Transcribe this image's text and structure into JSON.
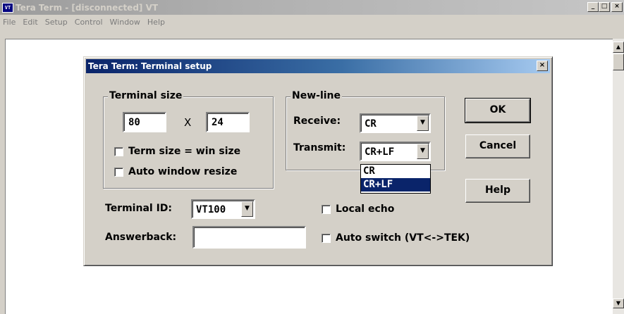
{
  "window": {
    "icon_text": "VT",
    "title": "Tera Term - [disconnected] VT",
    "min_glyph": "_",
    "max_glyph": "□",
    "close_glyph": "×"
  },
  "menu": [
    "File",
    "Edit",
    "Setup",
    "Control",
    "Window",
    "Help"
  ],
  "scrollbar": {
    "up_glyph": "▲",
    "down_glyph": "▼"
  },
  "dialog": {
    "title": "Tera Term: Terminal setup",
    "close_glyph": "×",
    "terminal_size": {
      "legend": "Terminal size",
      "cols": "80",
      "sep": "X",
      "rows": "24",
      "term_size_eq_win": {
        "label": "Term size = win size",
        "checked": false
      },
      "auto_resize": {
        "label": "Auto window resize",
        "checked": false
      }
    },
    "newline": {
      "legend": "New-line",
      "receive_label": "Receive:",
      "receive_value": "CR",
      "transmit_label": "Transmit:",
      "transmit_value": "CR+LF",
      "transmit_options": [
        "CR",
        "CR+LF"
      ],
      "transmit_selected": "CR+LF"
    },
    "terminal_id": {
      "label": "Terminal ID:",
      "value": "VT100"
    },
    "answerback": {
      "label": "Answerback:",
      "value": ""
    },
    "local_echo": {
      "label": "Local echo",
      "checked": false
    },
    "auto_switch": {
      "label": "Auto switch (VT<->TEK)",
      "checked": false
    },
    "buttons": {
      "ok": "OK",
      "cancel": "Cancel",
      "help": "Help"
    },
    "dropdown_arrow": "▼"
  }
}
